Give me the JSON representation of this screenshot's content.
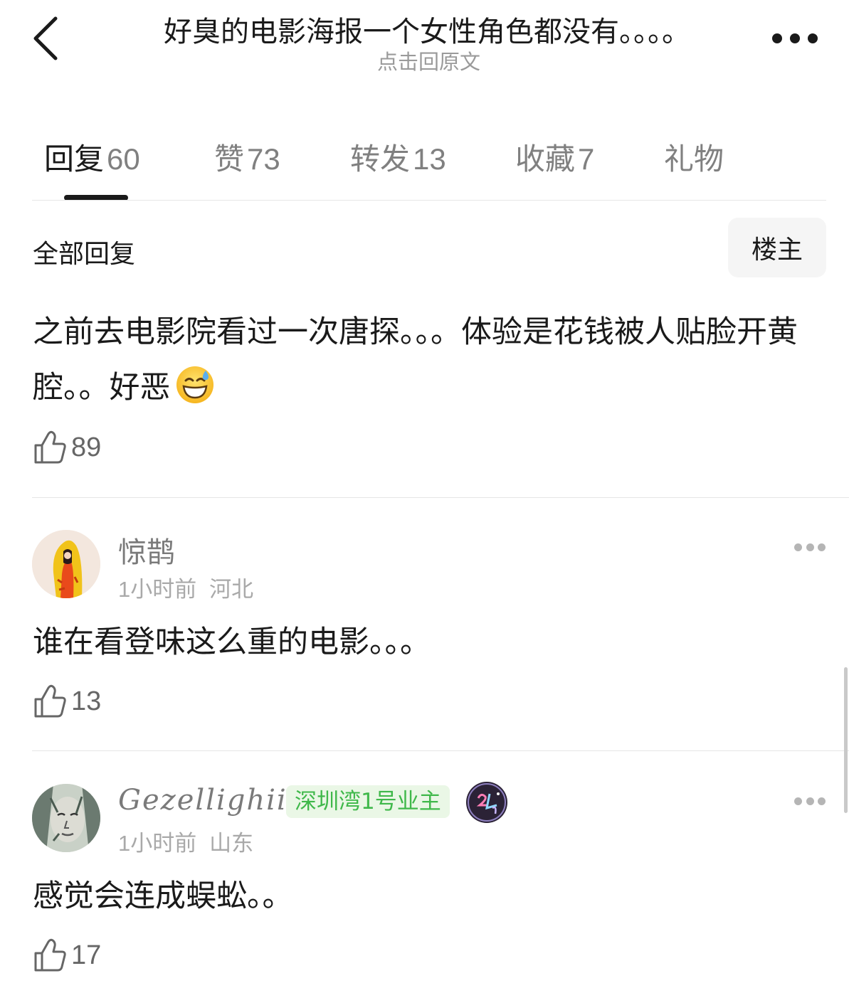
{
  "header": {
    "title": "好臭的电影海报一个女性角色都没有。。。。",
    "subtitle": "点击回原文"
  },
  "tabs": [
    {
      "label": "回复",
      "count": "60"
    },
    {
      "label": "赞",
      "count": "73"
    },
    {
      "label": "转发",
      "count": "13"
    },
    {
      "label": "收藏",
      "count": "7"
    },
    {
      "label": "礼物",
      "count": ""
    }
  ],
  "section": {
    "title": "全部回复",
    "filter_label": "楼主"
  },
  "original_post": {
    "text": "之前去电影院看过一次唐探。。。体验是花钱被人贴脸开黄腔。。好恶",
    "emoji": "grinning-sweat-emoji",
    "likes": "89"
  },
  "comments": [
    {
      "username": "惊鹊",
      "time": "1小时前",
      "location": "河北",
      "text": "谁在看登味这么重的电影。。。",
      "likes": "13",
      "avatar": "yellow-raincoat-girl-avatar"
    },
    {
      "username": "Gezellighiii",
      "badge": "深圳湾1号业主",
      "medal": "2024-medal-icon",
      "time": "1小时前",
      "location": "山东",
      "text": "感觉会连成蜈蚣。。",
      "likes": "17",
      "avatar": "sketch-face-avatar"
    }
  ],
  "colors": {
    "accent_dark": "#1a1a1a",
    "muted_text": "#808080",
    "badge_green": "#3fb84a",
    "badge_bg": "#eaf7e6"
  }
}
